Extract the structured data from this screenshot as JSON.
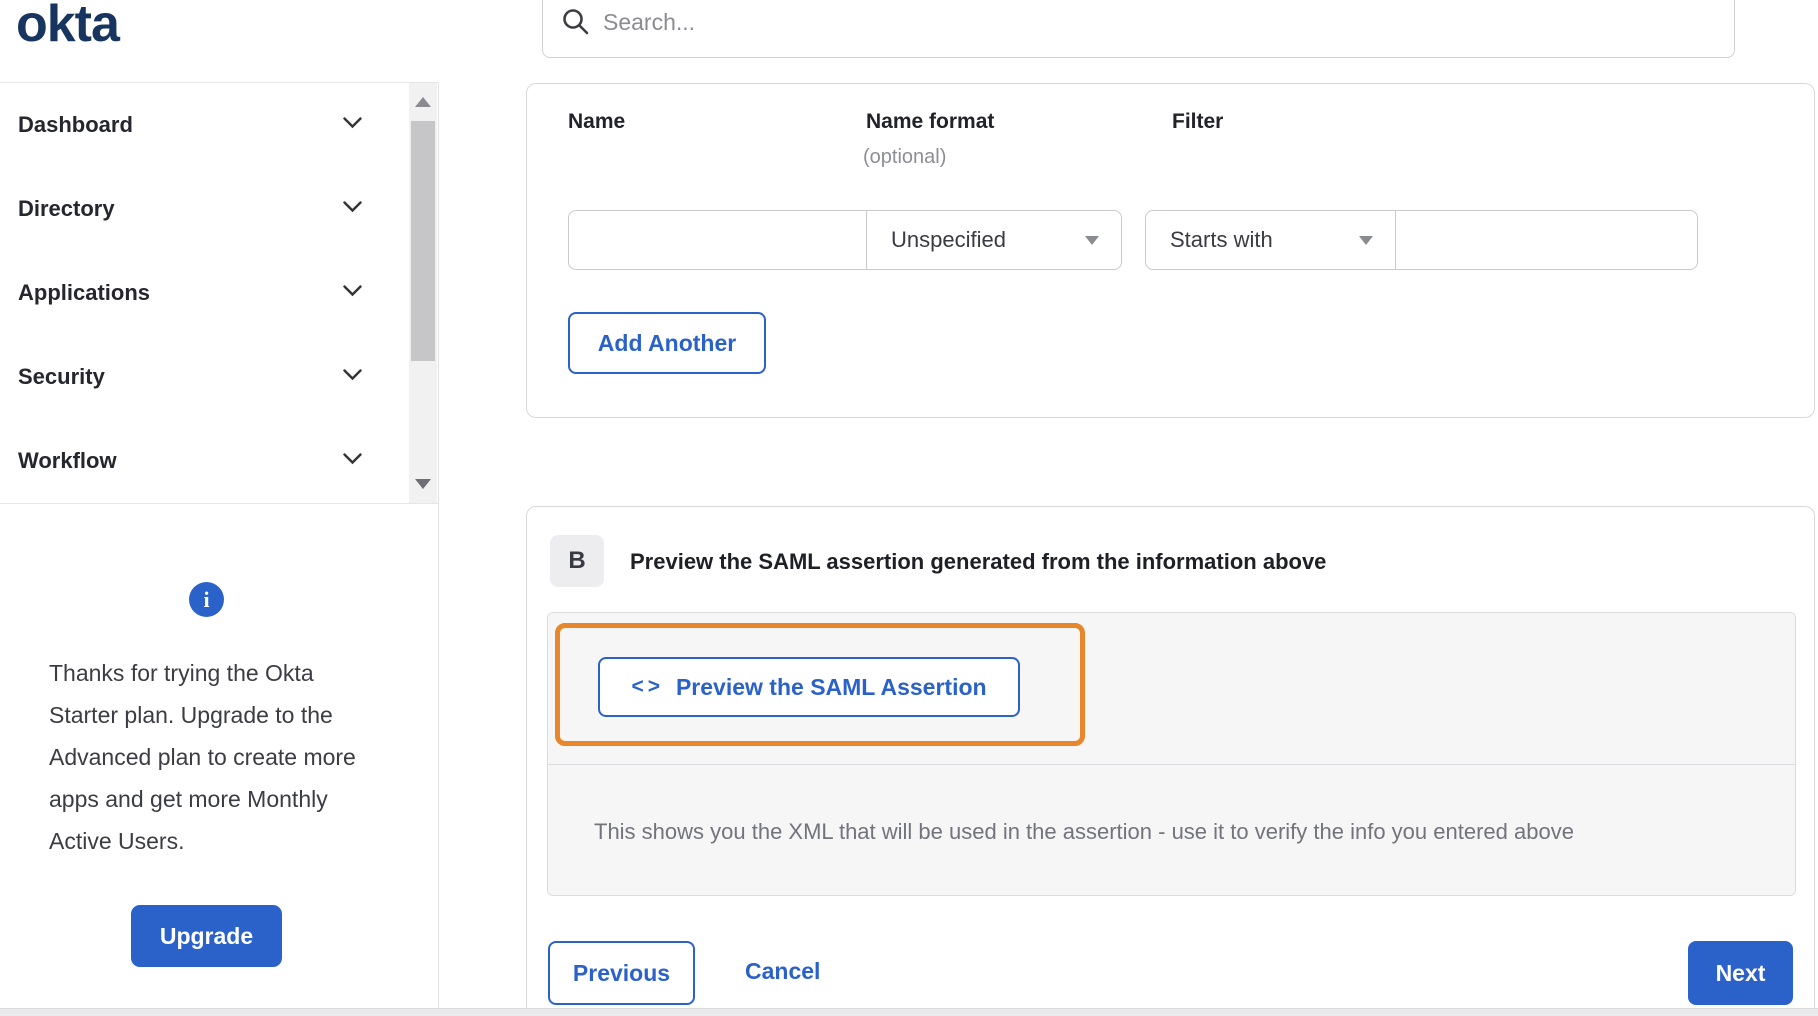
{
  "brand": {
    "logo_text": "okta"
  },
  "search": {
    "placeholder": "Search..."
  },
  "sidebar": {
    "items": [
      {
        "label": "Dashboard"
      },
      {
        "label": "Directory"
      },
      {
        "label": "Applications"
      },
      {
        "label": "Security"
      },
      {
        "label": "Workflow"
      }
    ],
    "promo": {
      "text": "Thanks for trying the Okta Starter plan. Upgrade to the Advanced plan to create more apps and get more Monthly Active Users.",
      "info_icon": "i",
      "upgrade_label": "Upgrade"
    }
  },
  "attribute_form": {
    "columns": {
      "name": "Name",
      "name_format": "Name format",
      "optional": "(optional)",
      "filter": "Filter"
    },
    "row": {
      "name_value": "",
      "name_format_value": "Unspecified",
      "filter_operator": "Starts with",
      "filter_value": ""
    },
    "add_another_label": "Add Another"
  },
  "preview_section": {
    "badge": "B",
    "heading": "Preview the SAML assertion generated from the information above",
    "code_icon": "<>",
    "button_label": "Preview the SAML Assertion",
    "description": "This shows you the XML that will be used in the assertion - use it to verify the info you entered above"
  },
  "footer": {
    "previous_label": "Previous",
    "cancel_label": "Cancel",
    "next_label": "Next"
  },
  "colors": {
    "accent_blue": "#2b62c9",
    "highlight_orange": "#e8862c",
    "logo_navy": "#17355f"
  }
}
